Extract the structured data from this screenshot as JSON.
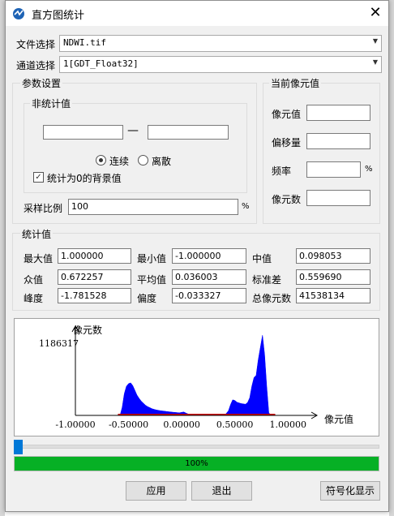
{
  "window": {
    "title": "直方图统计",
    "close_glyph": "✕"
  },
  "file": {
    "label": "文件选择",
    "value": "NDWI.tif"
  },
  "channel": {
    "label": "通道选择",
    "value": "1[GDT_Float32]"
  },
  "params": {
    "title": "参数设置",
    "nonstat": {
      "title": "非统计值",
      "min": "",
      "max": "",
      "dash": "—",
      "continuous": "连续",
      "discrete": "离散",
      "mode": "continuous",
      "zero_bg_label": "统计为0的背景值",
      "zero_bg_checked": true
    },
    "sample_label": "采样比例",
    "sample_value": "100",
    "sample_unit": "%"
  },
  "current": {
    "title": "当前像元值",
    "pixel_value_label": "像元值",
    "offset_label": "偏移量",
    "freq_label": "频率",
    "freq_unit": "%",
    "count_label": "像元数",
    "pixel_value": "",
    "offset": "",
    "freq": "",
    "count": ""
  },
  "stats": {
    "title": "统计值",
    "max_label": "最大值",
    "max": "1.000000",
    "min_label": "最小值",
    "min": "-1.000000",
    "median_label": "中值",
    "median": "0.098053",
    "mode_label": "众值",
    "mode": "0.672257",
    "mean_label": "平均值",
    "mean": "0.036003",
    "std_label": "标准差",
    "std": "0.559690",
    "kurt_label": "峰度",
    "kurt": "-1.781528",
    "skew_label": "偏度",
    "skew": "-0.033327",
    "total_label": "总像元数",
    "total": "41538134"
  },
  "chart_data": {
    "type": "area",
    "ylabel": "像元数",
    "xlabel": "像元值",
    "ymax_label": "1186317",
    "ylim": [
      0,
      1186317
    ],
    "xlim": [
      -1.0,
      1.25
    ],
    "xticks": [
      "-1.00000",
      "-0.50000",
      "0.00000",
      "0.50000",
      "1.00000"
    ],
    "xtick_values": [
      -1.0,
      -0.5,
      0.0,
      0.5,
      1.0
    ],
    "fill_color": "#0000ff",
    "baseline_color": "#cc0000",
    "x": [
      -0.58,
      -0.56,
      -0.54,
      -0.52,
      -0.5,
      -0.48,
      -0.46,
      -0.44,
      -0.42,
      -0.4,
      -0.38,
      -0.36,
      -0.34,
      -0.32,
      -0.3,
      -0.28,
      -0.26,
      -0.24,
      -0.22,
      -0.2,
      -0.18,
      -0.16,
      -0.14,
      -0.12,
      -0.1,
      -0.08,
      -0.06,
      -0.04,
      -0.02,
      0.0,
      0.02,
      0.04,
      0.06,
      0.08,
      0.1,
      0.12,
      0.14,
      0.16,
      0.18,
      0.2,
      0.22,
      0.24,
      0.26,
      0.28,
      0.3,
      0.32,
      0.34,
      0.36,
      0.38,
      0.4,
      0.42,
      0.44,
      0.46,
      0.48,
      0.5,
      0.52,
      0.54,
      0.56,
      0.58,
      0.6,
      0.62,
      0.64,
      0.66,
      0.68,
      0.7,
      0.72,
      0.74,
      0.76,
      0.78,
      0.8,
      0.82,
      0.84
    ],
    "values": [
      0,
      120000,
      320000,
      430000,
      470000,
      480000,
      440000,
      370000,
      300000,
      250000,
      210000,
      180000,
      150000,
      130000,
      115000,
      100000,
      90000,
      82000,
      76000,
      70000,
      66000,
      62000,
      58000,
      54000,
      50000,
      47000,
      44000,
      41000,
      38000,
      45000,
      50000,
      35000,
      22000,
      10000,
      4000,
      0,
      0,
      0,
      0,
      0,
      0,
      0,
      0,
      0,
      0,
      0,
      0,
      0,
      0,
      0,
      30000,
      70000,
      160000,
      230000,
      220000,
      195000,
      185000,
      175000,
      170000,
      165000,
      190000,
      260000,
      430000,
      560000,
      590000,
      820000,
      1000000,
      1186317,
      900000,
      430000,
      40000,
      0
    ]
  }
}
